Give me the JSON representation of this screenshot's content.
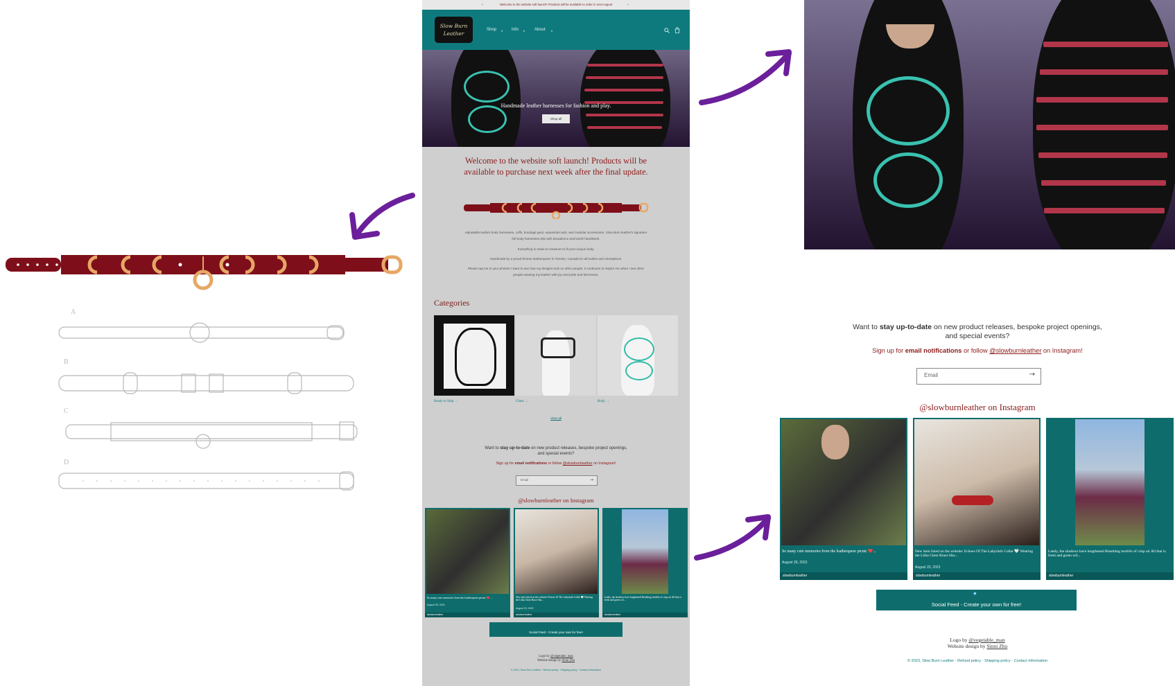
{
  "announcement": "Welcome to the website soft launch! Products will be available to order in next August",
  "logo_text": "Slow Burn Leather",
  "nav": {
    "items": [
      "Shop",
      "Info",
      "About"
    ],
    "search_icon": "search-icon",
    "cart_icon": "cart-icon"
  },
  "hero": {
    "headline": "Handmade leather harnesses for fashion and play.",
    "button": "Shop all"
  },
  "welcome_heading": "Welcome to the website soft launch! Products will be available to purchase next week after the final update.",
  "about": [
    "Adjustable leather body harnesses, cuffs, bondage gear, equestrian tack, and modular accessories. Slow Burn leather's signature full body harnesses drip with decadence and lavish handiwork.",
    "Everything is made to measure to fit your unique body.",
    "Handmade by a proud femme leatherqueer in Toronto, Canada for all bodies and orientations.",
    "Please tag me in your photos! I want to see how my designs look on other people. It continues to inspire me when I see other people wearing my leather with joy and pride and fierceness."
  ],
  "categories": {
    "title": "Categories",
    "items": [
      "Ready to Ship →",
      "Chest →",
      "Body →"
    ],
    "view_all": "View all"
  },
  "newsletter": {
    "line1_pre": "Want to ",
    "line1_bold": "stay up-to-date",
    "line1_post": " on new product releases, bespoke project openings,",
    "line2": "and special events?",
    "signup_pre": "Sign up for ",
    "signup_bold": "email notifications",
    "signup_mid": " or follow ",
    "signup_handle": "@slowburnleather",
    "signup_post": " on Instagram!",
    "email_placeholder": "Email"
  },
  "instagram": {
    "title": "@slowburnleather on Instagram",
    "posts": [
      {
        "caption": "So many cute memories from the leatherqueer picnic ❤️...",
        "date": "August 28, 2023",
        "user": "slowburnleather"
      },
      {
        "caption": "New item listed on the website: Echoes Of The Labyrinth Collar 🤍 Wearing the Lilka Chest Brace Har...",
        "date": "August 20, 2023",
        "user": "slowburnleather"
      },
      {
        "caption": "Lately, the shadows have lengthened Breathing tendrils of crisp air All that is fresh and green wil...",
        "date": "",
        "user": "slowburnleather"
      }
    ],
    "social_feed": "Social Feed - Create your own for free!"
  },
  "footer": {
    "logo_credit_pre": "Logo by ",
    "logo_credit_name": "@vegetable_man",
    "design_credit_pre": "Website design by ",
    "design_credit_name": "Sinni Zhu",
    "copyright": "© 2023, Slow Burn Leather",
    "links": [
      "Refund policy",
      "Shipping policy",
      "Contact information"
    ]
  },
  "colors": {
    "teal": "#0f7a7d",
    "burgundy": "#8b1a1a",
    "arrow_purple": "#6b1f9a",
    "site_bg": "#cfcfcf"
  },
  "sketch_labels": [
    "A",
    "B",
    "C",
    "D"
  ]
}
